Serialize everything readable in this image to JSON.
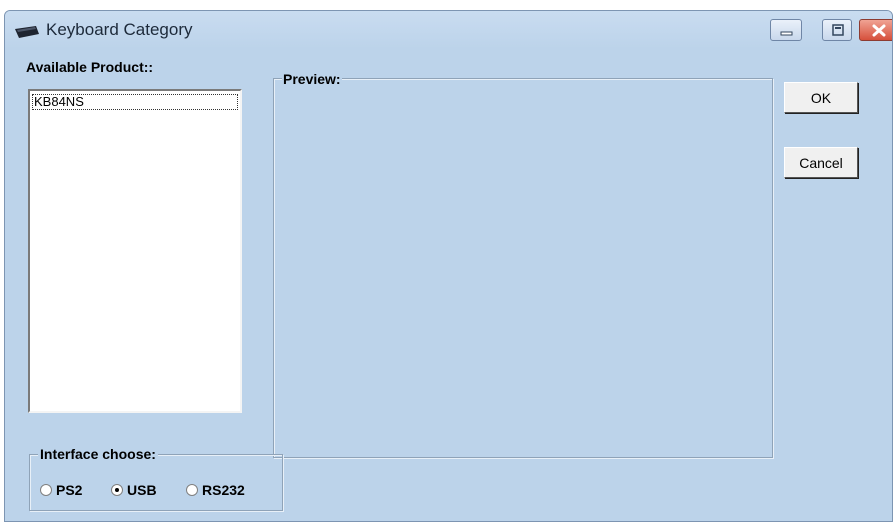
{
  "window": {
    "title": "Keyboard Category",
    "icon": "keyboard-icon",
    "controls": [
      "minimize-icon",
      "maximize-icon",
      "close-icon"
    ]
  },
  "products": {
    "label": "Available Product::",
    "items": [
      "KB84NS"
    ],
    "selected": "KB84NS"
  },
  "preview": {
    "label": "Preview:"
  },
  "buttons": {
    "ok": "OK",
    "cancel": "Cancel"
  },
  "interface": {
    "label": "Interface choose:",
    "options": [
      {
        "label": "PS2",
        "checked": false
      },
      {
        "label": "USB",
        "checked": true
      },
      {
        "label": "RS232",
        "checked": false
      }
    ]
  },
  "colors": {
    "window_bg": "#bcd3ea",
    "close_button": "#d6503c"
  }
}
